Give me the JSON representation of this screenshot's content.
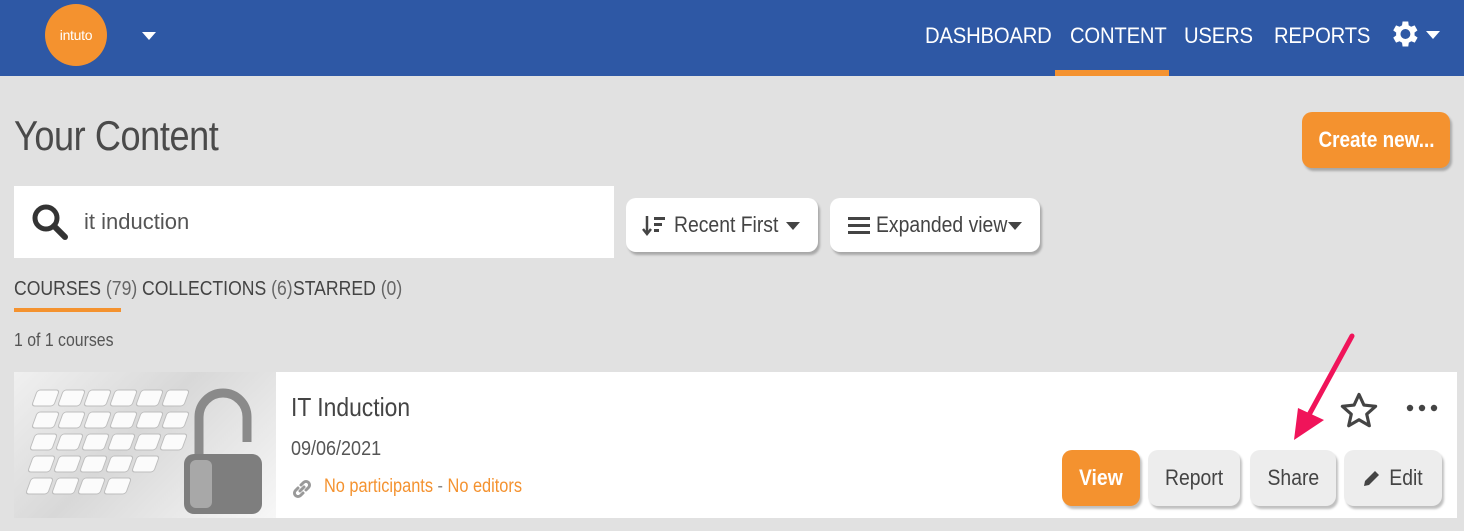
{
  "header": {
    "logo_text": "intuto",
    "nav": [
      {
        "label": "DASHBOARD",
        "active": false
      },
      {
        "label": "CONTENT",
        "active": true
      },
      {
        "label": "USERS",
        "active": false
      },
      {
        "label": "REPORTS",
        "active": false
      }
    ],
    "settings_icon": "gear-icon",
    "colors": {
      "bar": "#2e58a5",
      "accent": "#f4922f"
    }
  },
  "page": {
    "title": "Your Content",
    "create_button": "Create new...",
    "search": {
      "value": "it induction",
      "placeholder": ""
    },
    "sort_dropdown": "Recent First",
    "view_dropdown": "Expanded view"
  },
  "tabs": [
    {
      "label": "COURSES",
      "count": "(79)",
      "active": true
    },
    {
      "label": "COLLECTIONS",
      "count": "(6)",
      "active": false
    },
    {
      "label": "STARRED",
      "count": "(0)",
      "active": false
    }
  ],
  "result_count": "1 of 1 courses",
  "course": {
    "title": "IT Induction",
    "date": "09/06/2021",
    "participants": "No participants",
    "separator": "-",
    "editors": "No editors",
    "buttons": {
      "view": "View",
      "report": "Report",
      "share": "Share",
      "edit": "Edit"
    }
  }
}
